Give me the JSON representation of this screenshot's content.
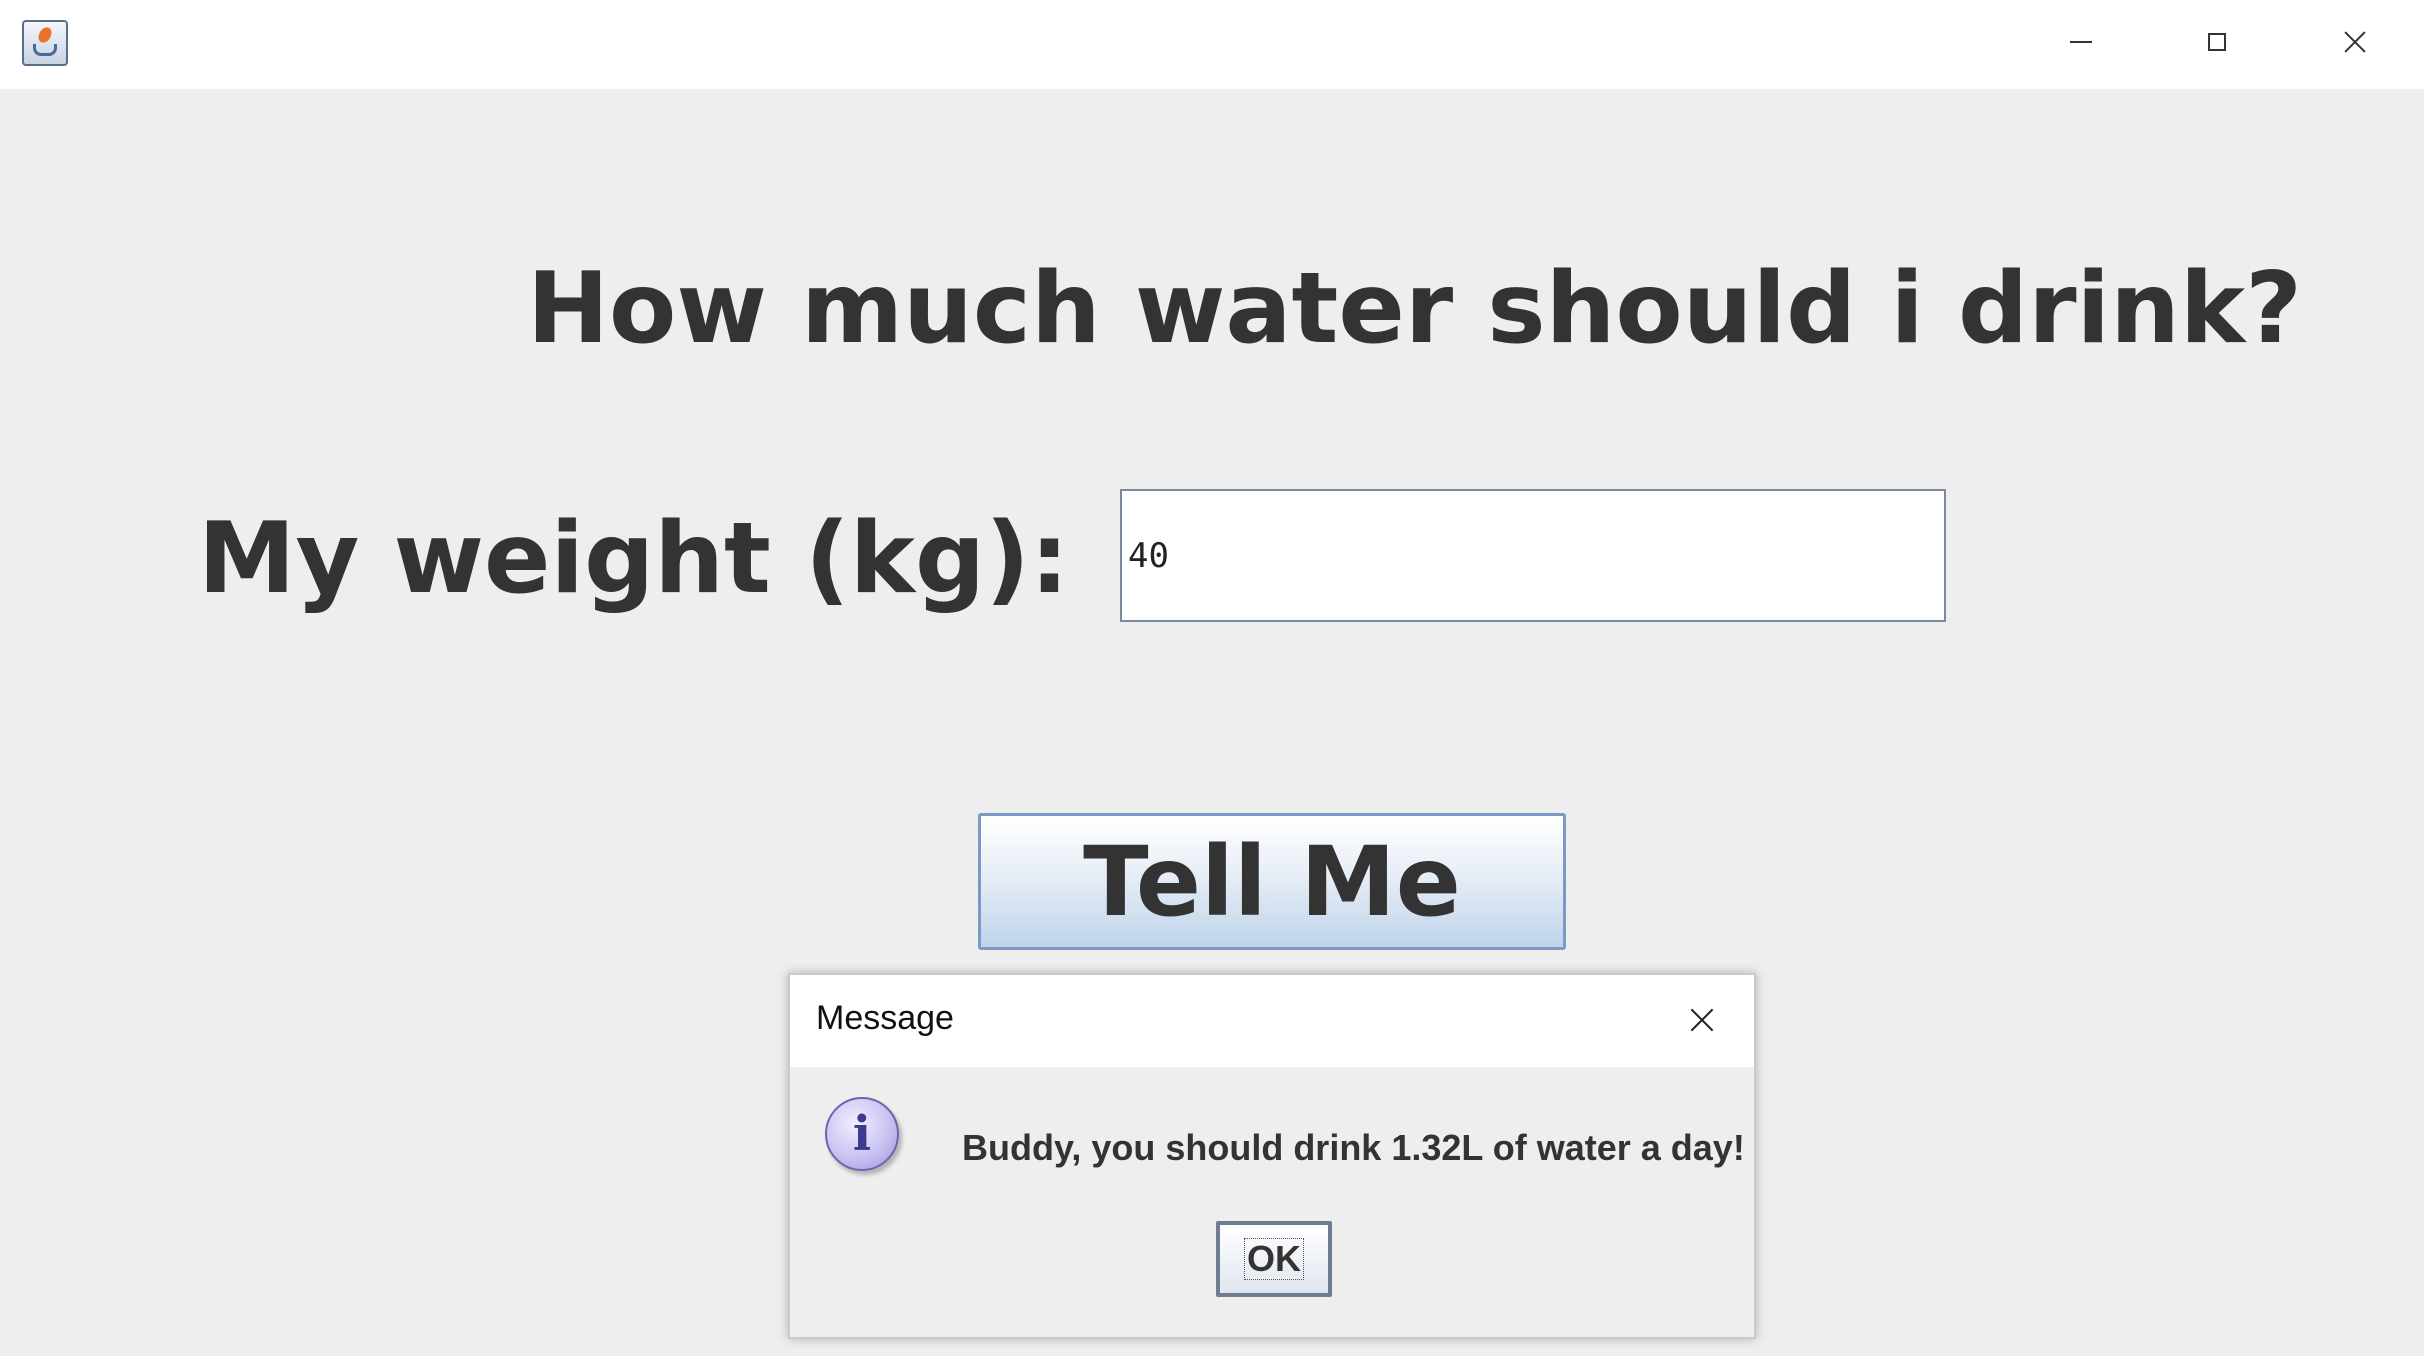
{
  "window": {
    "icon": "java-cup-icon",
    "controls": {
      "minimize": "minimize-icon",
      "maximize": "maximize-icon",
      "close": "close-icon"
    }
  },
  "main": {
    "heading": "How much water should i drink?",
    "weight_label": "My weight (kg):",
    "weight_value": "40",
    "tell_button_label": "Tell Me"
  },
  "dialog": {
    "title": "Message",
    "icon": "info-icon",
    "icon_glyph": "i",
    "message": "Buddy, you should drink 1.32L of water a day!",
    "ok_label": "OK"
  }
}
